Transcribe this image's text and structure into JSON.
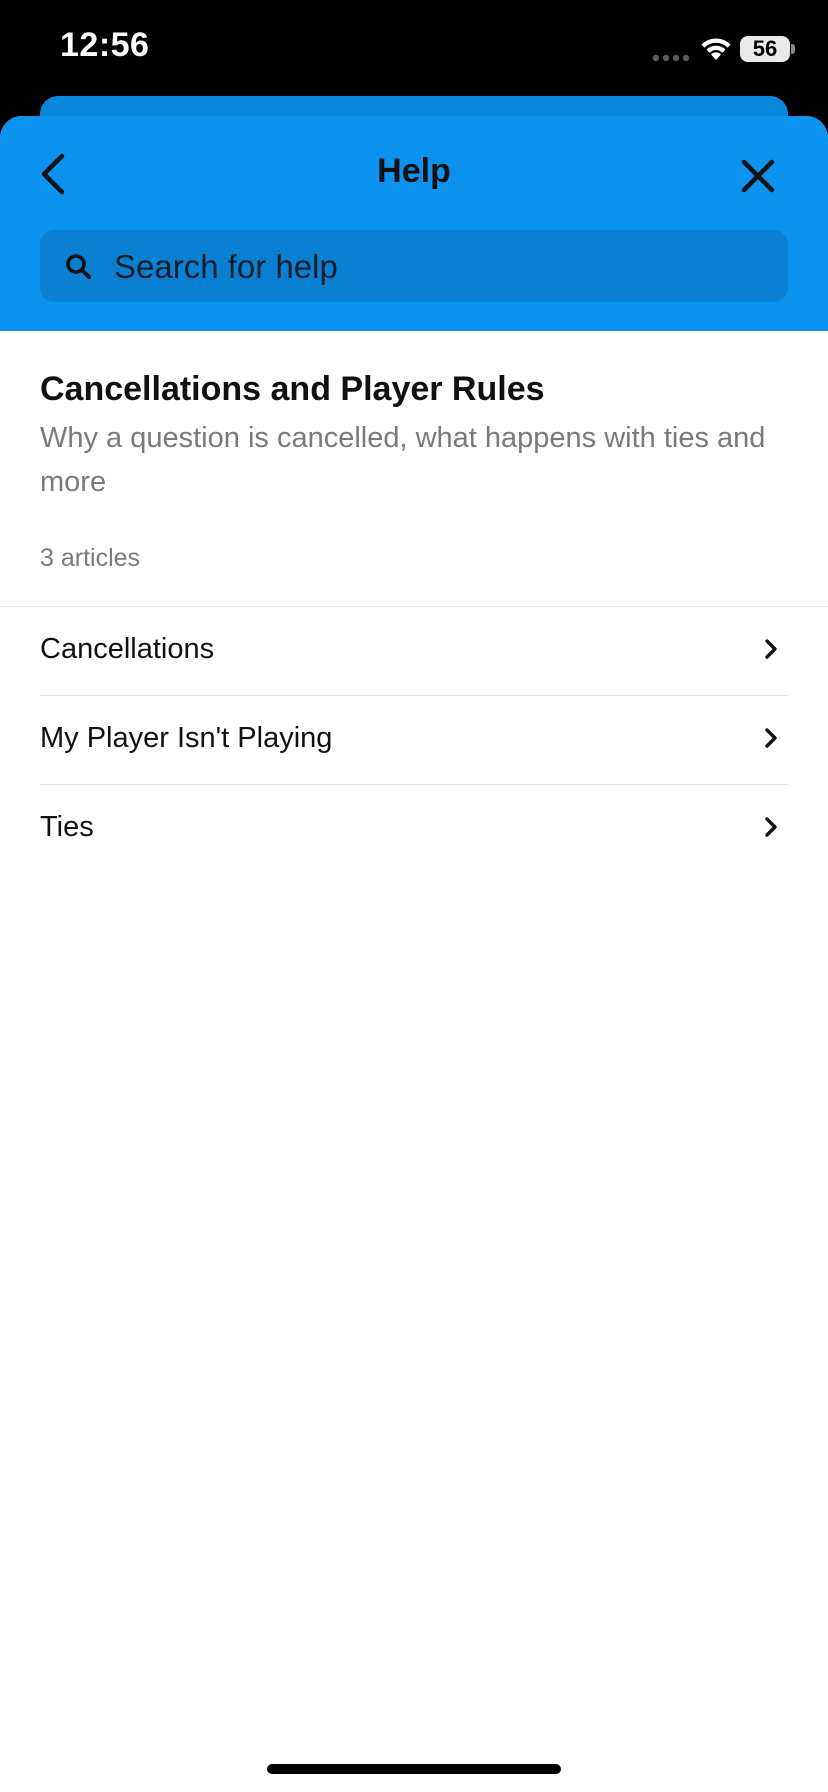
{
  "status_bar": {
    "time": "12:56",
    "battery": "56"
  },
  "header": {
    "title": "Help",
    "back_icon": "chevron-left-icon",
    "close_icon": "close-icon"
  },
  "search": {
    "placeholder": "Search for help",
    "icon": "search-icon"
  },
  "section": {
    "title": "Cancellations and Player Rules",
    "description": "Why a question is cancelled, what happens with ties and more",
    "article_count": "3 articles"
  },
  "articles": [
    {
      "label": "Cancellations"
    },
    {
      "label": "My Player Isn't Playing"
    },
    {
      "label": "Ties"
    }
  ],
  "colors": {
    "header_blue": "#0b93ef",
    "search_blue": "#0a80d3",
    "secondary_text": "#7a7a7a"
  }
}
